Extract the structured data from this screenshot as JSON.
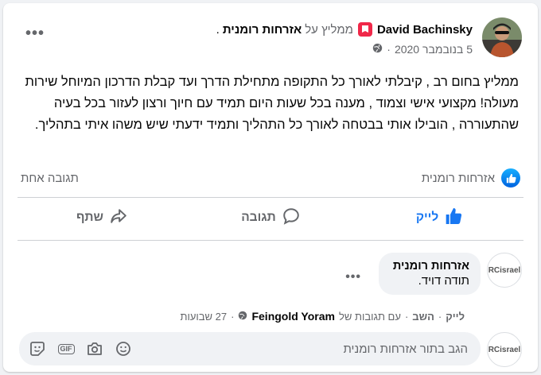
{
  "post": {
    "author": "David Bachinsky",
    "recommends_label": "ממליץ על",
    "page_name": "אזרחות רומנית",
    "date": "5 בנובמבר 2020",
    "date_separator": "·",
    "more_dots": "•••",
    "text": "ממליץ בחום רב , קיבלתי לאורך כל התקופה מתחילת הדרך ועד קבלת הדרכון המיוחל שירות מעולה! מקצועי אישי וצמוד , מענה בכל שעות היום תמיד עם חיוך ורצון לעזור בכל בעיה שהתעוררה , הובילו אותי בבטחה לאורך כל התהליך ותמיד ידעתי שיש משהו איתי בתהליך."
  },
  "stats": {
    "likers": "אזרחות רומנית",
    "comment_count": "תגובה אחת"
  },
  "actions": {
    "like": "לייק",
    "comment": "תגובה",
    "share": "שתף"
  },
  "comment": {
    "avatar_text": "RCisrael",
    "name": "אזרחות רומנית",
    "body": "תודה דויד.",
    "more_dots": "•••",
    "like": "לייק",
    "reply": "השב",
    "separator": "·",
    "responded_prefix": "עם תגובות של",
    "responded_name": "Feingold Yoram",
    "age": "27 שבועות"
  },
  "composer": {
    "avatar_text": "RCisrael",
    "placeholder": "הגב בתור אזרחות רומנית",
    "gif_label": "GIF"
  },
  "colors": {
    "accent": "#1877f2",
    "recommend": "#f02849",
    "muted": "#65676b"
  }
}
